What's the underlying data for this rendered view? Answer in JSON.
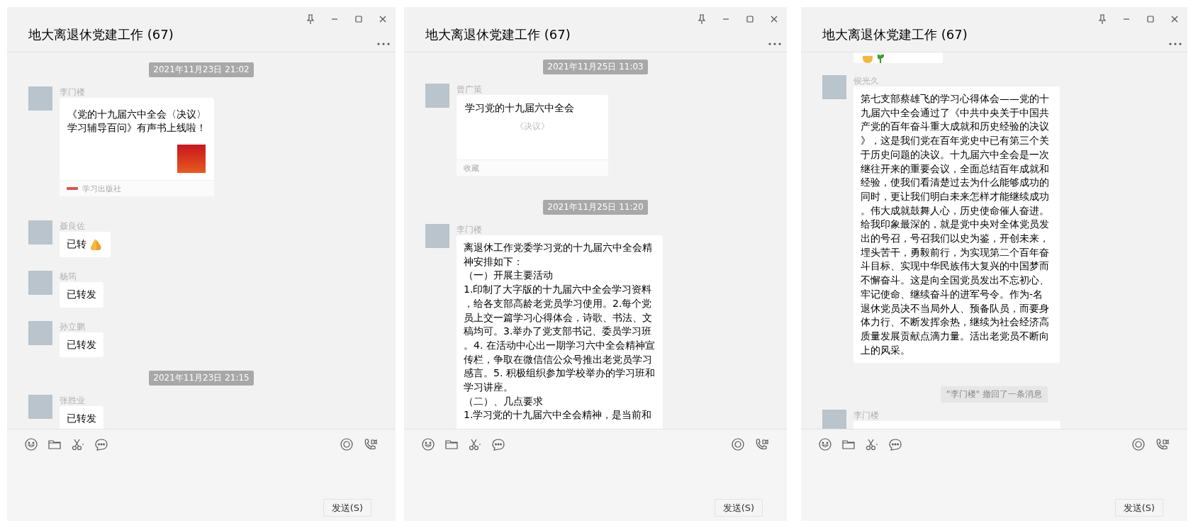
{
  "windows": [
    {
      "title": "地大离退休党建工作 (67)",
      "messages": [
        {
          "kind": "time",
          "text": "2021年11月23日 21:02"
        },
        {
          "kind": "article",
          "sender": "李门楼",
          "title": "《党的十九届六中全会〈决议〉学习辅导百问》有声书上线啦！",
          "source": "学习出版社"
        },
        {
          "kind": "text",
          "sender": "聂良佐",
          "paragraphs": [
            "已转"
          ],
          "has_emoji": true
        },
        {
          "kind": "text",
          "sender": "杨筠",
          "paragraphs": [
            "已转发"
          ],
          "has_emoji": false
        },
        {
          "kind": "text",
          "sender": "孙立鹏",
          "paragraphs": [
            "已转发"
          ],
          "has_emoji": false
        },
        {
          "kind": "time",
          "text": "2021年11月23日 21:15"
        },
        {
          "kind": "text",
          "sender": "张胜业",
          "paragraphs": [
            "已转发"
          ],
          "has_emoji": false
        }
      ],
      "send_label": "发送(S)"
    },
    {
      "title": "地大离退休党建工作 (67)",
      "messages": [
        {
          "kind": "time",
          "text": "2021年11月25日 11:03"
        },
        {
          "kind": "favorite",
          "sender": "曾广策",
          "title": "学习党的十九届六中全会",
          "subtitle": "《决议》",
          "footer": "收藏"
        },
        {
          "kind": "time",
          "text": "2021年11月25日 11:20"
        },
        {
          "kind": "text",
          "sender": "李门楼",
          "has_emoji": false,
          "paragraphs": [
            "离退休工作党委学习党的十九届六中全会精神安排如下：",
            "（一）开展主要活动",
            "1.印制了大字版的十九届六中全会学习资料，给各支部高龄老党员学习使用。2.每个党员上交一篇学习心得体会，诗歌、书法、文稿均可。3.举办了党支部书记、委员学习班。4. 在活动中心出一期学习六中全会精神宣传栏，争取在微信信公众号推出老党员学习感言。5. 积极组织参加学校举办的学习班和学习讲座。",
            "（二）、几点要求",
            "1.学习党的十九届六中全会精神，是当前和"
          ]
        }
      ],
      "send_label": "发送(S)"
    },
    {
      "title": "地大离退休党建工作 (67)",
      "messages": [
        {
          "kind": "clipped_top"
        },
        {
          "kind": "text",
          "sender": "侯光久",
          "has_emoji": false,
          "paragraphs": [
            "第七支部蔡雄飞的学习心得体会——党的十九届六中全会通过了《中共中央关于中国共产党的百年奋斗重大成就和历史经验的决议》，这是我们党在百年党史中已有第三个关于历史问题的决议。十九届六中全会是一次继往开来的重要会议，全面总结百年成就和经验，使我们看清楚过去为什么能够成功的同时，更让我们明白未来怎样才能继续成功。伟大成就鼓舞人心，历史使命催人奋进。给我印象最深的，就是党中央对全体党员发出的号召，号召我们以史为鉴，开创未来，埋头苦干，勇毅前行，为实现第二个百年奋斗目标、实现中华民族伟大复兴的中国梦而不懈奋斗。这是向全国党员发出不忘初心、牢记使命、继续奋斗的进军号令。作为-名退休党员决不当局外人、预备队员，而要身体力行、不断发挥余热，继续为社会经济高质量发展贡献点滴力量。活出老党员不断向上的风采。"
          ]
        },
        {
          "kind": "notice",
          "text": "\"李门楼\" 撤回了一条消息"
        },
        {
          "kind": "clipped_bottom",
          "sender": "李门楼"
        }
      ],
      "send_label": "发送(S)"
    }
  ]
}
